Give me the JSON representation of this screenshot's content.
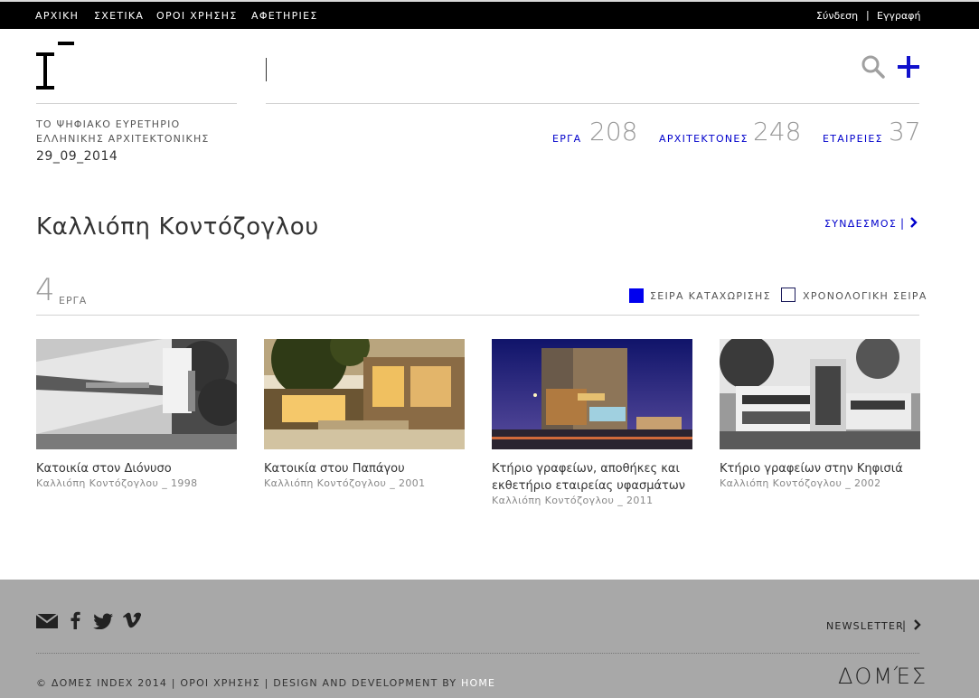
{
  "top_nav": {
    "items": [
      "ΑΡΧΙΚΗ",
      "ΣΧΕΤΙΚΑ",
      "ΟΡΟΙ ΧΡΗΣΗΣ",
      "ΑΦΕΤΗΡΙΕΣ"
    ],
    "login": "Σύνδεση",
    "separator": "|",
    "register": "Εγγραφή"
  },
  "header": {
    "logo_icon": "index-logo",
    "search_placeholder": "",
    "search_icon": "search-icon",
    "add_icon": "plus-icon",
    "tagline_line1": "ΤΟ ΨΗΦΙΑΚΟ ΕΥΡΕΤΗΡΙΟ",
    "tagline_line2": "ΕΛΛΗΝΙΚΗΣ ΑΡΧΙΤΕΚΤΟΝΙΚΗΣ",
    "date": "29_09_2014"
  },
  "stats": [
    {
      "label": "ΕΡΓΑ",
      "value": "208"
    },
    {
      "label": "ΑΡΧΙΤΕΚΤΟΝΕΣ",
      "value": "248"
    },
    {
      "label": "ΕΤΑΙΡΕΙΕΣ",
      "value": "37"
    }
  ],
  "profile": {
    "name": "Καλλιόπη Κοντόζογλου",
    "link_label": "ΣΥΝΔΕΣΜΟΣ",
    "link_separator": "|"
  },
  "works": {
    "count": "4",
    "count_label": "ΕΡΓΑ",
    "sort_registration": "ΣΕΙΡΑ ΚΑΤΑΧΩΡΙΣΗΣ",
    "sort_chronological": "ΧΡΟΝΟΛΟΓΙΚΗ ΣΕΙΡΑ",
    "sort_selected": "registration",
    "items": [
      {
        "title": "Κατοικία στον Διόνυσο",
        "subtitle": "Καλλιόπη Κοντόζογλου _ 1998"
      },
      {
        "title": "Κατοικία στου Παπάγου",
        "subtitle": "Καλλιόπη Κοντόζογλου _ 2001"
      },
      {
        "title": "Κτήριο γραφείων, αποθήκες και εκθετήριο εταιρείας υφασμάτων",
        "subtitle": "Καλλιόπη Κοντόζογλου _ 2011"
      },
      {
        "title": "Κτήριο γραφείων στην Κηφισιά",
        "subtitle": "Καλλιόπη Κοντόζογλου _ 2002"
      }
    ]
  },
  "footer": {
    "social_icons": [
      "mail-icon",
      "facebook-icon",
      "twitter-icon",
      "vimeo-icon"
    ],
    "newsletter": "NEWSLETTER",
    "newsletter_separator": "|",
    "copyright": "© ΔΟΜΕΣ INDEX 2014 | ΟΡΟΙ ΧΡΗΣΗΣ | DESIGN AND DEVELOPMENT BY ",
    "home_link": "HOME",
    "brand": "ΔΟΜΈΣ"
  },
  "colors": {
    "accent": "#0000cc",
    "topbar": "#000000",
    "footer_bg": "#a8a8a8"
  }
}
